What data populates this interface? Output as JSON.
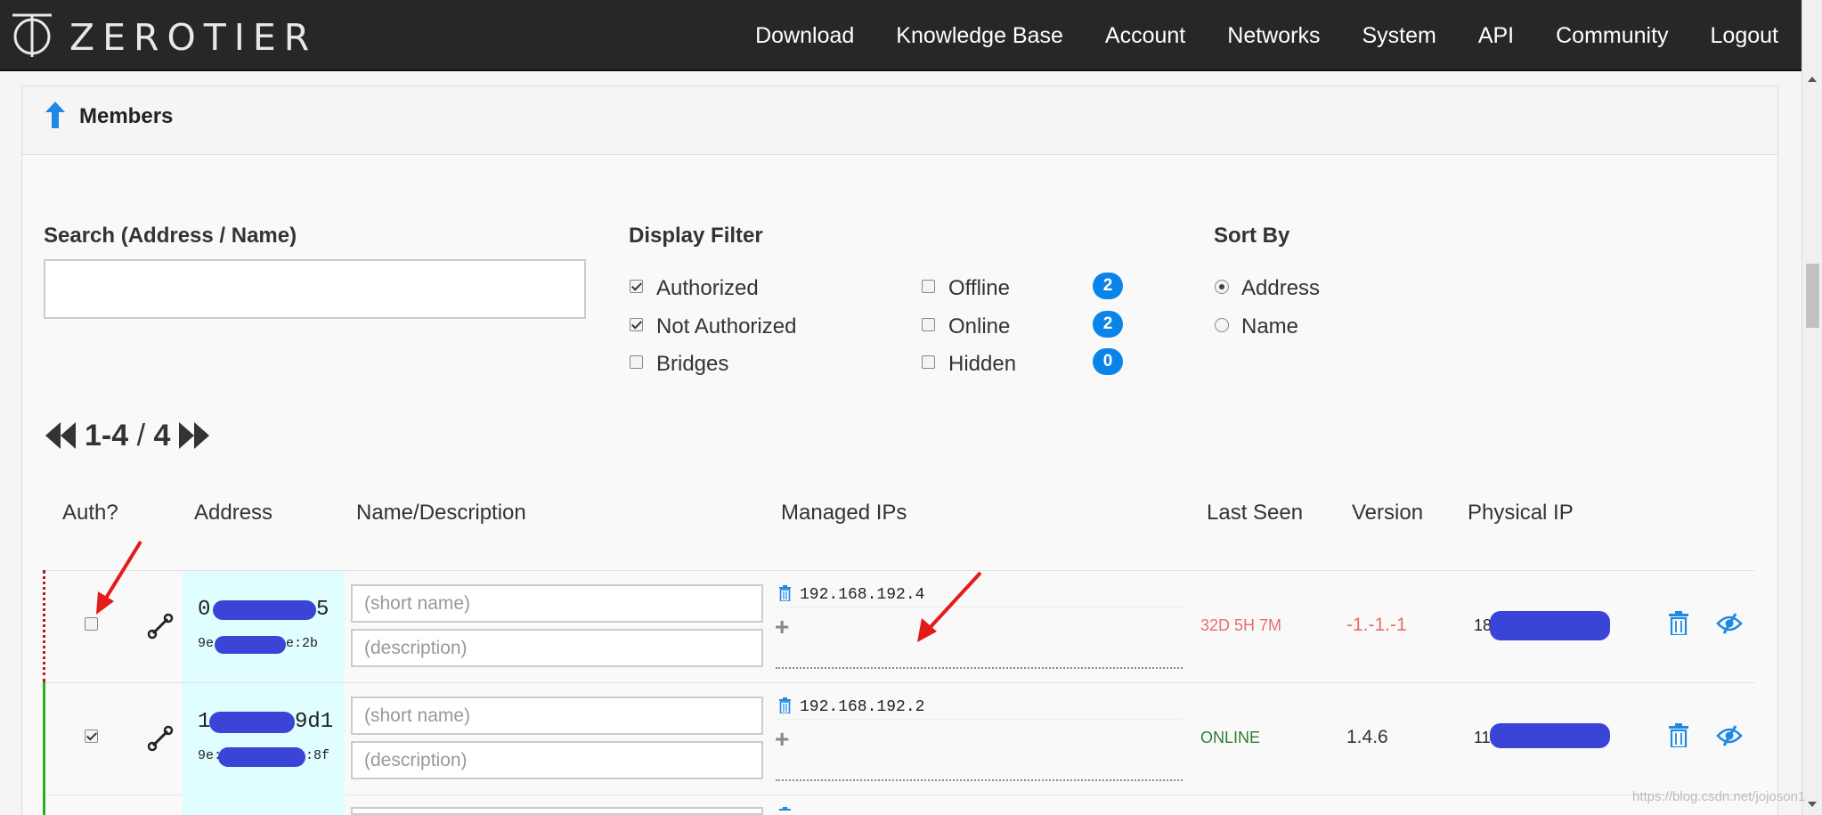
{
  "brand": {
    "name": "ZEROTIER"
  },
  "nav": [
    "Download",
    "Knowledge Base",
    "Account",
    "Networks",
    "System",
    "API",
    "Community",
    "Logout"
  ],
  "panel": {
    "title": "Members"
  },
  "search": {
    "label": "Search (Address / Name)",
    "value": "",
    "placeholder": ""
  },
  "display_filter": {
    "label": "Display Filter",
    "options": [
      {
        "label": "Authorized",
        "checked": true
      },
      {
        "label": "Not Authorized",
        "checked": true
      },
      {
        "label": "Bridges",
        "checked": false
      },
      {
        "label": "Offline",
        "checked": false,
        "count": "2"
      },
      {
        "label": "Online",
        "checked": false,
        "count": "2"
      },
      {
        "label": "Hidden",
        "checked": false,
        "count": "0"
      }
    ]
  },
  "sort_by": {
    "label": "Sort By",
    "options": [
      {
        "label": "Address",
        "selected": true
      },
      {
        "label": "Name",
        "selected": false
      }
    ]
  },
  "pager": {
    "range": "1-4",
    "separator": "/",
    "total": "4"
  },
  "columns": [
    "Auth?",
    "Address",
    "Name/Description",
    "Managed IPs",
    "Last Seen",
    "Version",
    "Physical IP"
  ],
  "members": [
    {
      "authorized": false,
      "addr_start": "0",
      "addr_end": "5",
      "sub_start": "9e",
      "sub_end": "e:2b",
      "name_placeholder": "(short name)",
      "desc_placeholder": "(description)",
      "ip": "192.168.192.4",
      "last_seen": "32D 5H 7M",
      "version": "-1.-1.-1",
      "phys_start": "18",
      "status_color": "#e66e6e"
    },
    {
      "authorized": true,
      "addr_start": "1",
      "addr_end": "9d1",
      "sub_start": "9e:",
      "sub_end": ":8f",
      "name_placeholder": "(short name)",
      "desc_placeholder": "(description)",
      "ip": "192.168.192.2",
      "last_seen": "ONLINE",
      "version": "1.4.6",
      "phys_start": "11",
      "status_color": "#2e7d32"
    }
  ],
  "watermark": "https://blog.csdn.net/jojoson1",
  "colors": {
    "badge": "#0a84e8",
    "unauthorized_mark": "#b71c1c",
    "authorized_mark": "#21b321",
    "address_bg": "#e0fdff",
    "annotation_red": "#e21b1b"
  }
}
